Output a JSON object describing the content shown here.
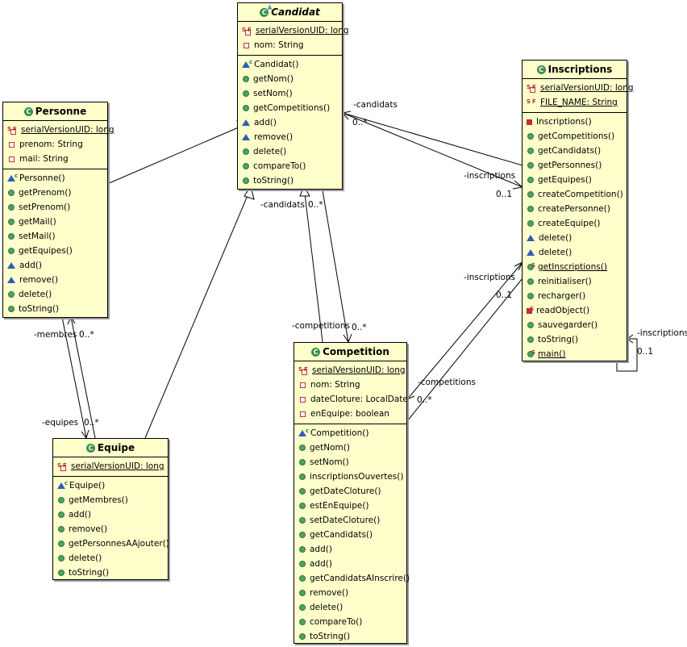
{
  "classes": {
    "candidat": {
      "name": "Candidat",
      "attributes": [
        "serialVersionUID: long",
        "nom: String"
      ],
      "operations": [
        "Candidat()",
        "getNom()",
        "setNom()",
        "getCompetitions()",
        "add()",
        "remove()",
        "delete()",
        "compareTo()",
        "toString()"
      ]
    },
    "personne": {
      "name": "Personne",
      "attributes": [
        "serialVersionUID: long",
        "prenom: String",
        "mail: String"
      ],
      "operations": [
        "Personne()",
        "getPrenom()",
        "setPrenom()",
        "getMail()",
        "setMail()",
        "getEquipes()",
        "add()",
        "remove()",
        "delete()",
        "toString()"
      ]
    },
    "inscriptions": {
      "name": "Inscriptions",
      "attributes": [
        "serialVersionUID: long",
        "FILE_NAME: String"
      ],
      "operations": [
        "Inscriptions()",
        "getCompetitions()",
        "getCandidats()",
        "getPersonnes()",
        "getEquipes()",
        "createCompetition()",
        "createPersonne()",
        "createEquipe()",
        "delete()",
        "delete()",
        "getInscriptions()",
        "reinitialiser()",
        "recharger()",
        "readObject()",
        "sauvegarder()",
        "toString()",
        "main()"
      ]
    },
    "competition": {
      "name": "Competition",
      "attributes": [
        "serialVersionUID: long",
        "nom: String",
        "dateCloture: LocalDate",
        "enEquipe: boolean"
      ],
      "operations": [
        "Competition()",
        "getNom()",
        "setNom()",
        "inscriptionsOuvertes()",
        "getDateCloture()",
        "estEnEquipe()",
        "setDateCloture()",
        "getCandidats()",
        "add()",
        "add()",
        "getCandidatsAInscrire()",
        "remove()",
        "delete()",
        "compareTo()",
        "toString()"
      ]
    },
    "equipe": {
      "name": "Equipe",
      "attributes": [
        "serialVersionUID: long"
      ],
      "operations": [
        "Equipe()",
        "getMembres()",
        "add()",
        "remove()",
        "getPersonnesAAjouter()",
        "delete()",
        "toString()"
      ]
    }
  },
  "edge_labels": {
    "candidat_inscriptions_role": "-candidats",
    "candidat_inscriptions_mult": "0..*",
    "inscriptions_role_top": "-inscriptions",
    "inscriptions_mult_top": "0..1",
    "candidats_role": "-candidats",
    "candidats_mult": "0..*",
    "competitions_role": "-competitions",
    "competitions_mult": "0..*",
    "inscriptions_role_mid": "-inscriptions",
    "inscriptions_mult_mid": "0..1",
    "competitions_role_right": "-competitions",
    "competitions_mult_right": "0..*",
    "self_role": "-inscriptions",
    "self_mult": "0..1",
    "membres_role": "-membres",
    "membres_mult": "0..*",
    "equipes_role": "-equipes",
    "equipes_mult": "0..*"
  }
}
